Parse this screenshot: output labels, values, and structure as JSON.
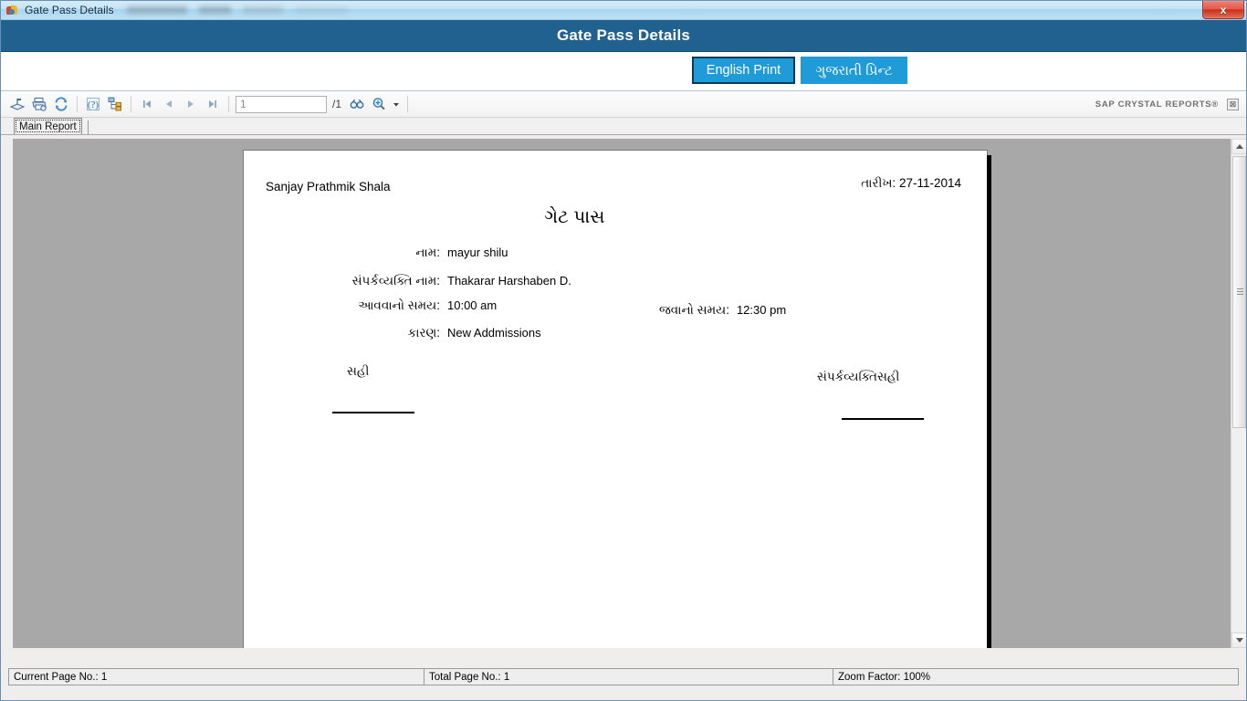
{
  "window": {
    "title": "Gate Pass Details",
    "close_label": "x",
    "obscured_text_present": true
  },
  "header": {
    "title": "Gate Pass Details"
  },
  "actions": {
    "english_print": "English Print",
    "gujarati_print": "ગુજરાતી પ્રિન્ટ"
  },
  "toolbar": {
    "icons": [
      {
        "name": "export-report-icon",
        "title": "Export Report"
      },
      {
        "name": "print-report-icon",
        "title": "Print Report"
      },
      {
        "name": "refresh-icon",
        "title": "Refresh"
      },
      {
        "name": "help-icon",
        "title": "Help"
      },
      {
        "name": "group-tree-icon",
        "title": "Toggle Group Tree"
      },
      {
        "name": "go-to-first-page-icon",
        "title": "Go To First Page"
      },
      {
        "name": "go-to-previous-page-icon",
        "title": "Go To Previous Page"
      },
      {
        "name": "go-to-next-page-icon",
        "title": "Go To Next Page"
      },
      {
        "name": "go-to-last-page-icon",
        "title": "Go To Last Page"
      },
      {
        "name": "find-text-icon",
        "title": "Find Text"
      },
      {
        "name": "zoom-icon",
        "title": "Zoom"
      }
    ],
    "page_number_value": "1",
    "page_number_placeholder": "1",
    "page_total": "/1",
    "brand": "SAP CRYSTAL REPORTS®",
    "close_label": "⊠"
  },
  "tabs": {
    "main_report": "Main Report"
  },
  "report": {
    "school_name": "Sanjay Prathmik Shala",
    "date_label": "તારીખ:",
    "date_value": "27-11-2014",
    "title": "ગેટ પાસ",
    "fields": [
      {
        "key": "name",
        "label": "નામ:",
        "value": "mayur shilu"
      },
      {
        "key": "contact",
        "label": "સંપર્કવ્યક્તિ નામ:",
        "value": "Thakarar Harshaben  D."
      },
      {
        "key": "intime",
        "label": "આવવાનો સમય:",
        "value": "10:00 am"
      },
      {
        "key": "reason",
        "label": "કારણ:",
        "value": "New Addmissions"
      },
      {
        "key": "outtime",
        "label": "જવાનો સમય:",
        "value": "12:30 pm"
      }
    ],
    "signature_left": "સહી",
    "signature_right": "સંપર્કવ્યક્તિસહી"
  },
  "statusbar": {
    "current_page": "Current Page No.: 1",
    "total_page": "Total Page No.: 1",
    "zoom_factor": "Zoom Factor: 100%"
  },
  "colors": {
    "header_blue": "#21618f",
    "button_blue": "#1f9bd8",
    "viewer_gray": "#a8a8a8",
    "close_red": "#c9301c"
  }
}
